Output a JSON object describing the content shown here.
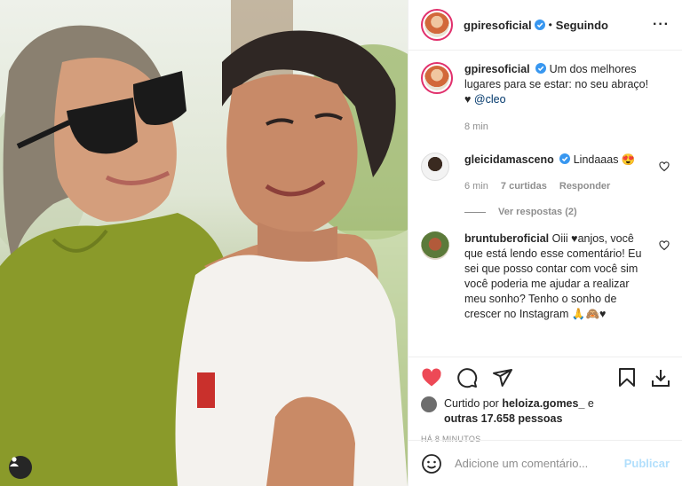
{
  "post": {
    "author": {
      "username": "gpiresoficial",
      "verified": true,
      "follow_state": "Seguindo",
      "separator": "•"
    },
    "caption": {
      "username": "gpiresoficial",
      "text": "Um dos melhores lugares para se estar: no seu abraço!",
      "heart": "♥",
      "mention": "@cleo",
      "time": "8 min"
    },
    "comments": [
      {
        "username": "gleicidamasceno",
        "verified": true,
        "text": "Lindaaas 😍",
        "time": "6 min",
        "likes": "7 curtidas",
        "reply": "Responder",
        "view_replies": "Ver respostas (2)"
      },
      {
        "username": "bruntuberoficial",
        "text": "Oiii ♥anjos, você que está lendo esse comentário! Eu sei que posso contar com você sim você poderia me ajudar a realizar meu sonho? Tenho o sonho de crescer no Instagram 🙏🙈♥"
      }
    ],
    "likes": {
      "prefix": "Curtido por",
      "user": "heloiza.gomes_",
      "joiner": "e",
      "others": "outras 17.658 pessoas"
    },
    "timestamp": "HÁ 8 MINUTOS",
    "add_comment": {
      "placeholder": "Adicione um comentário...",
      "publish": "Publicar"
    },
    "icons": {
      "like": "heart-filled-icon",
      "comment": "comment-icon",
      "share": "share-icon",
      "save": "bookmark-icon",
      "download": "download-icon",
      "more": "more-options-icon",
      "emoji": "emoji-icon",
      "tag": "user-tag-icon"
    },
    "colors": {
      "like_red": "#ed4956",
      "verified_blue": "#3897f0",
      "link": "#00376b",
      "muted": "#8e8e8e",
      "publish_disabled": "#b2dffc"
    }
  }
}
